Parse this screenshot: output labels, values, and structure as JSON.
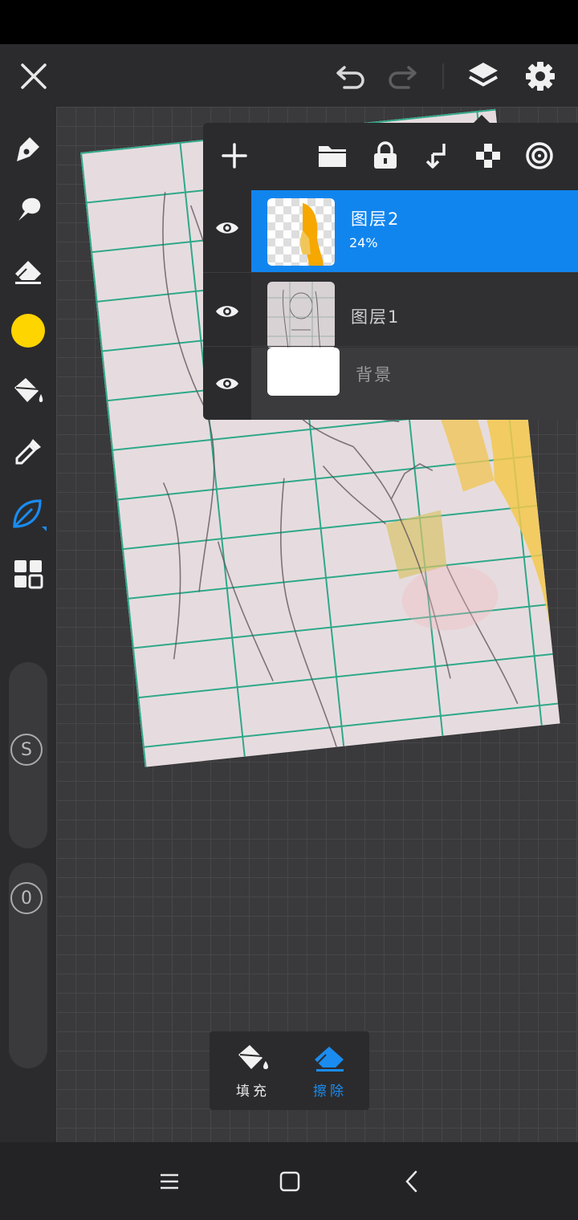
{
  "top_bar": {
    "icons": [
      "close-icon",
      "undo-icon",
      "redo-icon",
      "layers-icon",
      "settings-icon"
    ]
  },
  "left_toolbar": {
    "tools": [
      "pen-tool-icon",
      "smudge-tool-icon",
      "eraser-tool-icon",
      "color-picker",
      "fill-bucket-icon",
      "eyedropper-icon",
      "leaf-brush-icon",
      "grid-menu-icon"
    ],
    "current_color": "#ffd500",
    "size_slider_label": "S",
    "opacity_slider_label": "0"
  },
  "layers_panel": {
    "toolbar_icons": [
      "add-layer-icon",
      "folder-icon",
      "lock-icon",
      "merge-down-icon",
      "transparency-icon",
      "clipping-icon"
    ],
    "layers": [
      {
        "name": "图层2",
        "opacity": "24%",
        "selected": true
      },
      {
        "name": "图层1",
        "opacity": "",
        "selected": false
      },
      {
        "name": "背景",
        "opacity": "",
        "selected": false
      }
    ]
  },
  "bottom_popup": {
    "fill_label": "填充",
    "erase_label": "擦除"
  },
  "colors": {
    "accent": "#1185ee",
    "panel": "#2b2b2d",
    "canvas_bg": "#3a3a3c"
  }
}
